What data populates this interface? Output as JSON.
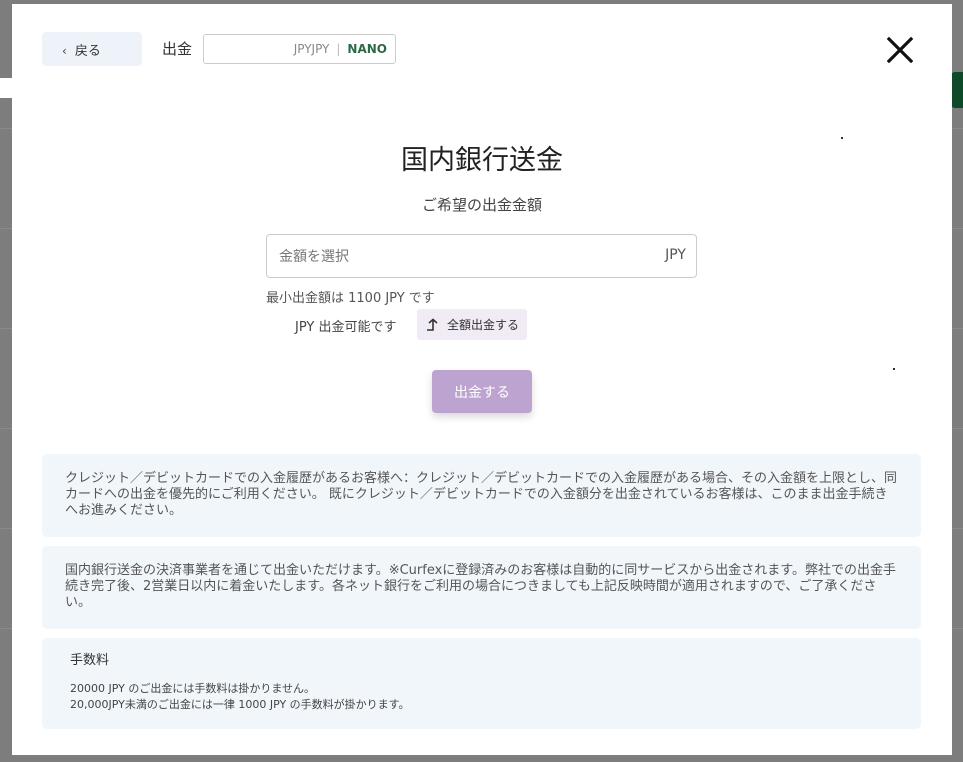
{
  "header": {
    "back_label": "戻る",
    "section_label": "出金",
    "currency": "JPYJPY",
    "network": "NANO"
  },
  "main": {
    "title": "国内銀行送金",
    "subtitle": "ご希望の出金金額",
    "amount_placeholder": "金額を選択",
    "amount_unit": "JPY",
    "min_note": "最小出金額は 1100 JPY です",
    "available_text": "JPY 出金可能です",
    "withdraw_all_label": "全額出金する",
    "submit_label": "出金する"
  },
  "notices": {
    "card_notice": "クレジット／デビットカードでの入金履歴があるお客様へ：クレジット／デビットカードでの入金履歴がある場合、その入金額を上限とし、同カードへの出金を優先的にご利用ください。 既にクレジット／デビットカードでの入金額分を出金されているお客様は、このまま出金手続きへお進みください。",
    "bank_notice": "国内銀行送金の決済事業者を通じて出金いただけます。※Curfexに登録済みのお客様は自動的に同サービスから出金されます。弊社での出金手続き完了後、2営業日以内に着金いたします。各ネット銀行をご利用の場合につきましても上記反映時間が適用されますので、ご了承ください。",
    "fee_title": "手数料",
    "fee_line_1": "20000 JPY のご出金には手数料は掛かりません。",
    "fee_line_2": "20,000JPY未満のご出金には一律 1000 JPY の手数料が掛かります。"
  },
  "colors": {
    "accent_purple": "#bda4d0",
    "network_green": "#2b6b45",
    "info_bg": "#f1f6fb"
  }
}
